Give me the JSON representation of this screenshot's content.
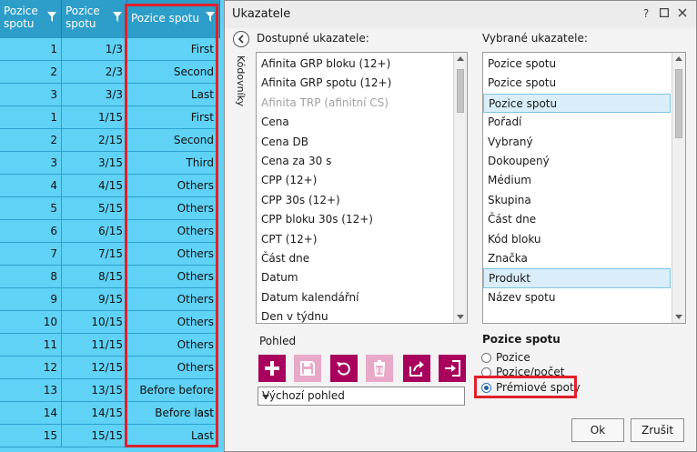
{
  "grid": {
    "headers": [
      "Pozice spotu",
      "Pozice spotu",
      "Pozice spotu"
    ],
    "rows": [
      [
        "1",
        "1/3",
        "First"
      ],
      [
        "2",
        "2/3",
        "Second"
      ],
      [
        "3",
        "3/3",
        "Last"
      ],
      [
        "1",
        "1/15",
        "First"
      ],
      [
        "2",
        "2/15",
        "Second"
      ],
      [
        "3",
        "3/15",
        "Third"
      ],
      [
        "4",
        "4/15",
        "Others"
      ],
      [
        "5",
        "5/15",
        "Others"
      ],
      [
        "6",
        "6/15",
        "Others"
      ],
      [
        "7",
        "7/15",
        "Others"
      ],
      [
        "8",
        "8/15",
        "Others"
      ],
      [
        "9",
        "9/15",
        "Others"
      ],
      [
        "10",
        "10/15",
        "Others"
      ],
      [
        "11",
        "11/15",
        "Others"
      ],
      [
        "12",
        "12/15",
        "Others"
      ],
      [
        "13",
        "13/15",
        "Before before last"
      ],
      [
        "14",
        "14/15",
        "Before last"
      ],
      [
        "15",
        "15/15",
        "Last"
      ]
    ]
  },
  "dialog": {
    "title": "Ukazatele",
    "help_glyph": "?",
    "side_tab": "Kódovníky",
    "available_label": "Dostupné ukazatele:",
    "selected_label": "Vybrané ukazatele:",
    "available_items": [
      {
        "label": "Afinita GRP bloku (12+)",
        "disabled": false
      },
      {
        "label": "Afinita GRP spotu (12+)",
        "disabled": false
      },
      {
        "label": "Afinita TRP (afinitní CS)",
        "disabled": true
      },
      {
        "label": "Cena",
        "disabled": false
      },
      {
        "label": "Cena DB",
        "disabled": false
      },
      {
        "label": "Cena za 30 s",
        "disabled": false
      },
      {
        "label": "CPP (12+)",
        "disabled": false
      },
      {
        "label": "CPP 30s (12+)",
        "disabled": false
      },
      {
        "label": "CPP bloku 30s (12+)",
        "disabled": false
      },
      {
        "label": "CPT (12+)",
        "disabled": false
      },
      {
        "label": "Část dne",
        "disabled": false
      },
      {
        "label": "Datum",
        "disabled": false
      },
      {
        "label": "Datum kalendářní",
        "disabled": false
      },
      {
        "label": "Den v týdnu",
        "disabled": false
      }
    ],
    "selected_items": [
      {
        "label": "Pozice spotu",
        "selected": false
      },
      {
        "label": "Pozice spotu",
        "selected": false
      },
      {
        "label": "Pozice spotu",
        "selected": true
      },
      {
        "label": "Pořadí",
        "selected": false
      },
      {
        "label": "Vybraný",
        "selected": false
      },
      {
        "label": "Dokoupený",
        "selected": false
      },
      {
        "label": "Médium",
        "selected": false
      },
      {
        "label": "Skupina",
        "selected": false
      },
      {
        "label": "Část dne",
        "selected": false
      },
      {
        "label": "Kód bloku",
        "selected": false
      },
      {
        "label": "Značka",
        "selected": false
      },
      {
        "label": "Produkt",
        "selected": true
      },
      {
        "label": "Název spotu",
        "selected": false
      }
    ],
    "view_label": "Pohled",
    "view_select": "Výchozí pohled",
    "toolbar_icons": [
      "add-icon",
      "save-icon",
      "undo-icon",
      "delete-icon",
      "export-icon",
      "import-icon"
    ],
    "options_title": "Pozice spotu",
    "options": [
      {
        "label": "Pozice",
        "checked": false
      },
      {
        "label": "Pozice/počet",
        "checked": false
      },
      {
        "label": "Prémiové spoty",
        "checked": true
      }
    ],
    "ok_label": "Ok",
    "cancel_label": "Zrušit"
  },
  "colors": {
    "grid_cell": "#5fd2f5",
    "grid_header": "#2d9ec9",
    "highlight_red": "#e0202a",
    "toolbar_accent": "#a8005c"
  }
}
